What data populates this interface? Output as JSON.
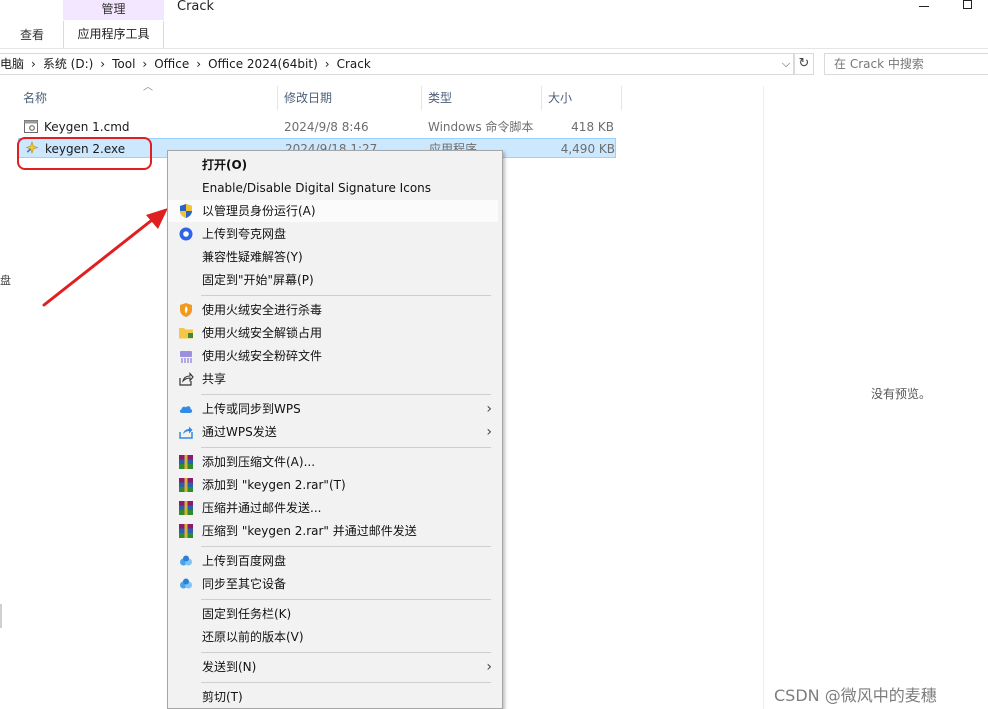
{
  "ribbon": {
    "manage_tab": "管理",
    "view_tab": "查看",
    "app_tools_tab": "应用程序工具",
    "window_title": "Crack"
  },
  "address": {
    "crumbs": [
      "此电脑",
      "系统 (D:)",
      "Tool",
      "Office",
      "Office 2024(64bit)",
      "Crack"
    ],
    "search_placeholder": "在 Crack 中搜索"
  },
  "columns": {
    "name": "名称",
    "date": "修改日期",
    "type": "类型",
    "size": "大小"
  },
  "files": [
    {
      "name": "Keygen 1.cmd",
      "date": "2024/9/8 8:46",
      "type": "Windows 命令脚本",
      "size": "418 KB"
    },
    {
      "name": "keygen 2.exe",
      "date": "2024/9/18 1:27",
      "type": "应用程序",
      "size": "4,490 KB"
    }
  ],
  "nav_fragment": "盘",
  "preview": {
    "empty_text": "没有预览。"
  },
  "watermark": "CSDN @微风中的麦穗",
  "context_menu": {
    "open": "打开(O)",
    "sig_icons": "Enable/Disable Digital Signature Icons",
    "run_as_admin": "以管理员身份运行(A)",
    "upload_quark": "上传到夸克网盘",
    "compat": "兼容性疑难解答(Y)",
    "pin_start": "固定到\"开始\"屏幕(P)",
    "hr_scan": "使用火绒安全进行杀毒",
    "hr_unlock": "使用火绒安全解锁占用",
    "hr_shred": "使用火绒安全粉碎文件",
    "share": "共享",
    "wps_sync": "上传或同步到WPS",
    "wps_send": "通过WPS发送",
    "rar_add": "添加到压缩文件(A)...",
    "rar_add_named": "添加到 \"keygen 2.rar\"(T)",
    "rar_email": "压缩并通过邮件发送...",
    "rar_named_email": "压缩到 \"keygen 2.rar\" 并通过邮件发送",
    "baidu_upload": "上传到百度网盘",
    "baidu_sync": "同步至其它设备",
    "pin_taskbar": "固定到任务栏(K)",
    "restore": "还原以前的版本(V)",
    "send_to": "发送到(N)",
    "cut": "剪切(T)"
  },
  "colors": {
    "selection": "#cce8ff",
    "manage_tab_bg": "#f3e6ff",
    "annotation_red": "#e02020"
  }
}
